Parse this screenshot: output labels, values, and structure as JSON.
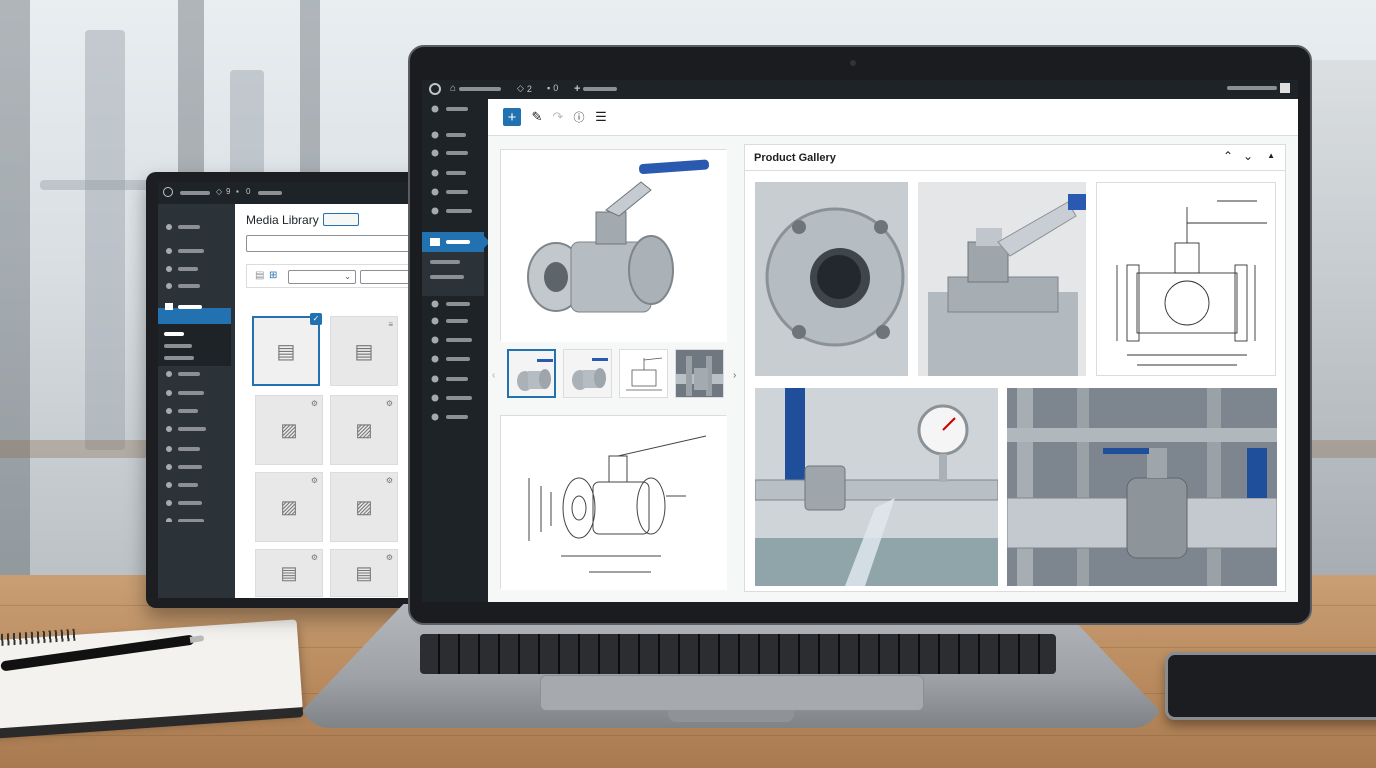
{
  "laptop_admin_bar": {
    "update_count": "2",
    "comment_count": "0",
    "new_icon": "+"
  },
  "editor_toolbar": {
    "add_block": "+",
    "tools": [
      "pencil-icon",
      "redo-icon",
      "info-icon",
      "list-view-icon"
    ]
  },
  "gallery_block": {
    "title": "Product Gallery",
    "controls": [
      "chevron-up-icon",
      "chevron-down-icon",
      "collapse-icon"
    ],
    "tiles": [
      "flange-closeup-photo",
      "valve-handle-photo",
      "valve-cross-section-drawing",
      "valve-gauge-water-photo",
      "pipeline-valve-photo"
    ]
  },
  "product_images": {
    "main": "ball-valve-photo",
    "thumbnails": [
      "ball-valve-thumb-1",
      "ball-valve-thumb-2",
      "drawing-thumb",
      "pipeline-thumb"
    ],
    "drawing": "ball-valve-dimension-drawing"
  },
  "media_library": {
    "title": "Media Library",
    "admin_bar_count": "9",
    "comment_count": "0"
  },
  "colors": {
    "admin_dark": "#1d2327",
    "admin_mid": "#2c3338",
    "accent": "#2271b1",
    "steel": "#a9b0b6"
  }
}
